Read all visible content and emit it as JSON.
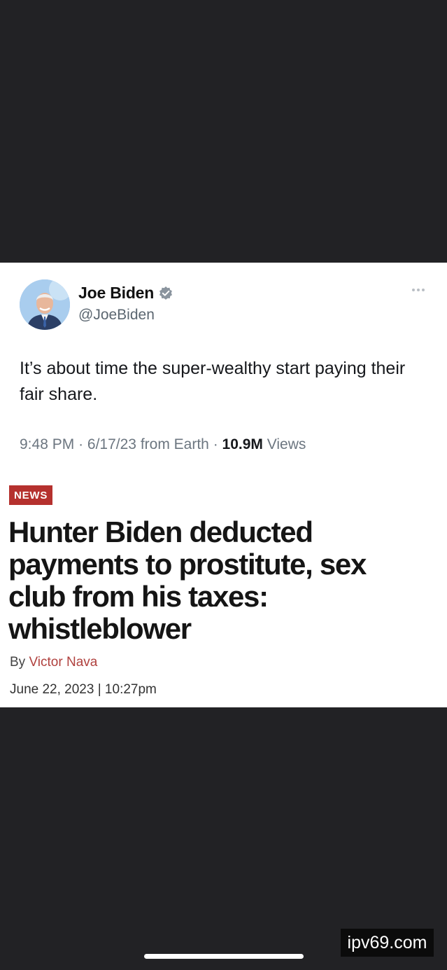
{
  "tweet": {
    "author_name": "Joe Biden",
    "verified_icon": "verified-badge-icon",
    "handle": "@JoeBiden",
    "more_icon": "more-options-icon",
    "text": "It’s about time the super-wealthy start paying their fair share.",
    "time": "9:48 PM",
    "separator": "·",
    "date": "6/17/23",
    "source": "from Earth",
    "views_count": "10.9M",
    "views_label": "Views"
  },
  "article": {
    "tag": "NEWS",
    "headline": "Hunter Biden deducted payments to prostitute, sex club from his taxes: whistleblower",
    "by_label": "By",
    "author": "Victor Nava",
    "dateline": "June 22, 2023 | 10:27pm"
  },
  "watermark": "ipv69.com",
  "colors": {
    "background": "#222225",
    "card": "#ffffff",
    "news_tag": "#b5312e",
    "author_link": "#b0413e"
  }
}
